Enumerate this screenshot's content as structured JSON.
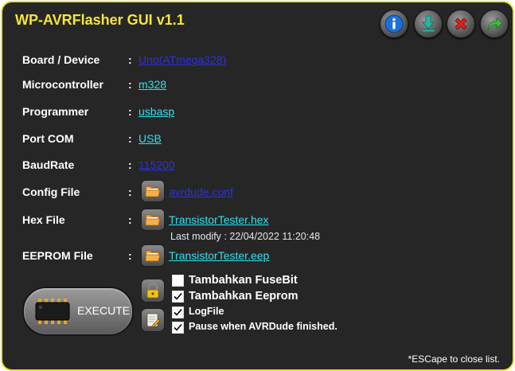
{
  "window": {
    "title": "WP-AVRFlasher GUI v1.1",
    "border_color": "#e8e62a",
    "background": "#262626"
  },
  "titlebar_buttons": [
    {
      "name": "info-icon",
      "color": "#1e6fd6"
    },
    {
      "name": "download-icon",
      "color": "#2bb3a2"
    },
    {
      "name": "close-icon",
      "color": "#e02020"
    },
    {
      "name": "forward-arrow-icon",
      "color": "#3fbf3f"
    }
  ],
  "fields": {
    "board": {
      "label": "Board / Device",
      "colon": ":",
      "value": "Uno(ATmega328)"
    },
    "mcu": {
      "label": "Microcontroller",
      "colon": ":",
      "value": "m328"
    },
    "programmer": {
      "label": "Programmer",
      "colon": ":",
      "value": "usbasp"
    },
    "port": {
      "label": "Port COM",
      "colon": ":",
      "value": "USB"
    },
    "baud": {
      "label": "BaudRate",
      "colon": ":",
      "value": "115200"
    },
    "config": {
      "label": "Config File",
      "colon": ":",
      "value": "avrdude.conf"
    },
    "hex": {
      "label": "Hex File",
      "colon": ":",
      "value": "TransistorTester.hex",
      "last_modify": "Last modify : 22/04/2022 11:20:48"
    },
    "eeprom": {
      "label": "EEPROM File",
      "colon": ":",
      "value": "TransistorTester.eep"
    }
  },
  "execute": {
    "label": "EXECUTE"
  },
  "options": [
    {
      "label": "Tambahkan FuseBit",
      "checked": false
    },
    {
      "label": "Tambahkan Eeprom",
      "checked": true
    },
    {
      "label": "LogFile",
      "checked": true
    },
    {
      "label": "Pause when AVRDude finished.",
      "checked": true
    }
  ],
  "footer": "*ESCape to close list."
}
